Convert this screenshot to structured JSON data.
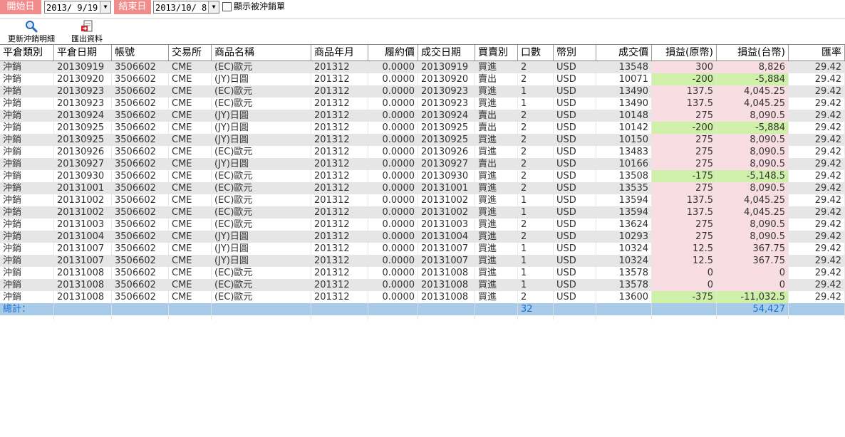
{
  "filter": {
    "start_label": "開始日",
    "start_date": "2013/ 9/19",
    "end_label": "結束日",
    "end_date": "2013/10/ 8",
    "show_offset_label": "顯示被沖銷單",
    "show_offset_checked": false
  },
  "toolbar": {
    "refresh_label": "更新沖銷明細",
    "export_label": "匯出資料",
    "refresh_icon": "magnifier-icon",
    "export_icon": "export-document-icon"
  },
  "colors": {
    "date_label_bg": "#f08c8c",
    "buy_text": "#e0407a",
    "sell_text": "#2d8f2d",
    "profit_bg": "#f8dde2",
    "loss_bg": "#cef0a8",
    "total_row_bg": "#a9cbea"
  },
  "columns": [
    "平倉類別",
    "平倉日期",
    "帳號",
    "交易所",
    "商品名稱",
    "商品年月",
    "履約價",
    "成交日期",
    "買賣別",
    "口數",
    "幣別",
    "成交價",
    "損益(原幣)",
    "損益(台幣)",
    "匯率"
  ],
  "rows": [
    [
      "沖銷",
      "20130919",
      "3506602",
      "CME",
      "(EC)歐元",
      "201312",
      "0.0000",
      "20130919",
      "買進",
      "2",
      "USD",
      "13548",
      "300",
      "8,826",
      "29.42"
    ],
    [
      "沖銷",
      "20130920",
      "3506602",
      "CME",
      "(JY)日圓",
      "201312",
      "0.0000",
      "20130920",
      "賣出",
      "2",
      "USD",
      "10071",
      "-200",
      "-5,884",
      "29.42"
    ],
    [
      "沖銷",
      "20130923",
      "3506602",
      "CME",
      "(EC)歐元",
      "201312",
      "0.0000",
      "20130923",
      "買進",
      "1",
      "USD",
      "13490",
      "137.5",
      "4,045.25",
      "29.42"
    ],
    [
      "沖銷",
      "20130923",
      "3506602",
      "CME",
      "(EC)歐元",
      "201312",
      "0.0000",
      "20130923",
      "買進",
      "1",
      "USD",
      "13490",
      "137.5",
      "4,045.25",
      "29.42"
    ],
    [
      "沖銷",
      "20130924",
      "3506602",
      "CME",
      "(JY)日圓",
      "201312",
      "0.0000",
      "20130924",
      "賣出",
      "2",
      "USD",
      "10148",
      "275",
      "8,090.5",
      "29.42"
    ],
    [
      "沖銷",
      "20130925",
      "3506602",
      "CME",
      "(JY)日圓",
      "201312",
      "0.0000",
      "20130925",
      "賣出",
      "2",
      "USD",
      "10142",
      "-200",
      "-5,884",
      "29.42"
    ],
    [
      "沖銷",
      "20130925",
      "3506602",
      "CME",
      "(JY)日圓",
      "201312",
      "0.0000",
      "20130925",
      "買進",
      "2",
      "USD",
      "10150",
      "275",
      "8,090.5",
      "29.42"
    ],
    [
      "沖銷",
      "20130926",
      "3506602",
      "CME",
      "(EC)歐元",
      "201312",
      "0.0000",
      "20130926",
      "買進",
      "2",
      "USD",
      "13483",
      "275",
      "8,090.5",
      "29.42"
    ],
    [
      "沖銷",
      "20130927",
      "3506602",
      "CME",
      "(JY)日圓",
      "201312",
      "0.0000",
      "20130927",
      "賣出",
      "2",
      "USD",
      "10166",
      "275",
      "8,090.5",
      "29.42"
    ],
    [
      "沖銷",
      "20130930",
      "3506602",
      "CME",
      "(EC)歐元",
      "201312",
      "0.0000",
      "20130930",
      "買進",
      "2",
      "USD",
      "13508",
      "-175",
      "-5,148.5",
      "29.42"
    ],
    [
      "沖銷",
      "20131001",
      "3506602",
      "CME",
      "(EC)歐元",
      "201312",
      "0.0000",
      "20131001",
      "買進",
      "2",
      "USD",
      "13535",
      "275",
      "8,090.5",
      "29.42"
    ],
    [
      "沖銷",
      "20131002",
      "3506602",
      "CME",
      "(EC)歐元",
      "201312",
      "0.0000",
      "20131002",
      "買進",
      "1",
      "USD",
      "13594",
      "137.5",
      "4,045.25",
      "29.42"
    ],
    [
      "沖銷",
      "20131002",
      "3506602",
      "CME",
      "(EC)歐元",
      "201312",
      "0.0000",
      "20131002",
      "買進",
      "1",
      "USD",
      "13594",
      "137.5",
      "4,045.25",
      "29.42"
    ],
    [
      "沖銷",
      "20131003",
      "3506602",
      "CME",
      "(EC)歐元",
      "201312",
      "0.0000",
      "20131003",
      "買進",
      "2",
      "USD",
      "13624",
      "275",
      "8,090.5",
      "29.42"
    ],
    [
      "沖銷",
      "20131004",
      "3506602",
      "CME",
      "(JY)日圓",
      "201312",
      "0.0000",
      "20131004",
      "買進",
      "2",
      "USD",
      "10293",
      "275",
      "8,090.5",
      "29.42"
    ],
    [
      "沖銷",
      "20131007",
      "3506602",
      "CME",
      "(JY)日圓",
      "201312",
      "0.0000",
      "20131007",
      "買進",
      "1",
      "USD",
      "10324",
      "12.5",
      "367.75",
      "29.42"
    ],
    [
      "沖銷",
      "20131007",
      "3506602",
      "CME",
      "(JY)日圓",
      "201312",
      "0.0000",
      "20131007",
      "買進",
      "1",
      "USD",
      "10324",
      "12.5",
      "367.75",
      "29.42"
    ],
    [
      "沖銷",
      "20131008",
      "3506602",
      "CME",
      "(EC)歐元",
      "201312",
      "0.0000",
      "20131008",
      "買進",
      "1",
      "USD",
      "13578",
      "0",
      "0",
      "29.42"
    ],
    [
      "沖銷",
      "20131008",
      "3506602",
      "CME",
      "(EC)歐元",
      "201312",
      "0.0000",
      "20131008",
      "買進",
      "1",
      "USD",
      "13578",
      "0",
      "0",
      "29.42"
    ],
    [
      "沖銷",
      "20131008",
      "3506602",
      "CME",
      "(EC)歐元",
      "201312",
      "0.0000",
      "20131008",
      "買進",
      "2",
      "USD",
      "13600",
      "-375",
      "-11,032.5",
      "29.42"
    ]
  ],
  "total": {
    "label": "總計：",
    "qty": "32",
    "twd_pnl": "54,427"
  }
}
